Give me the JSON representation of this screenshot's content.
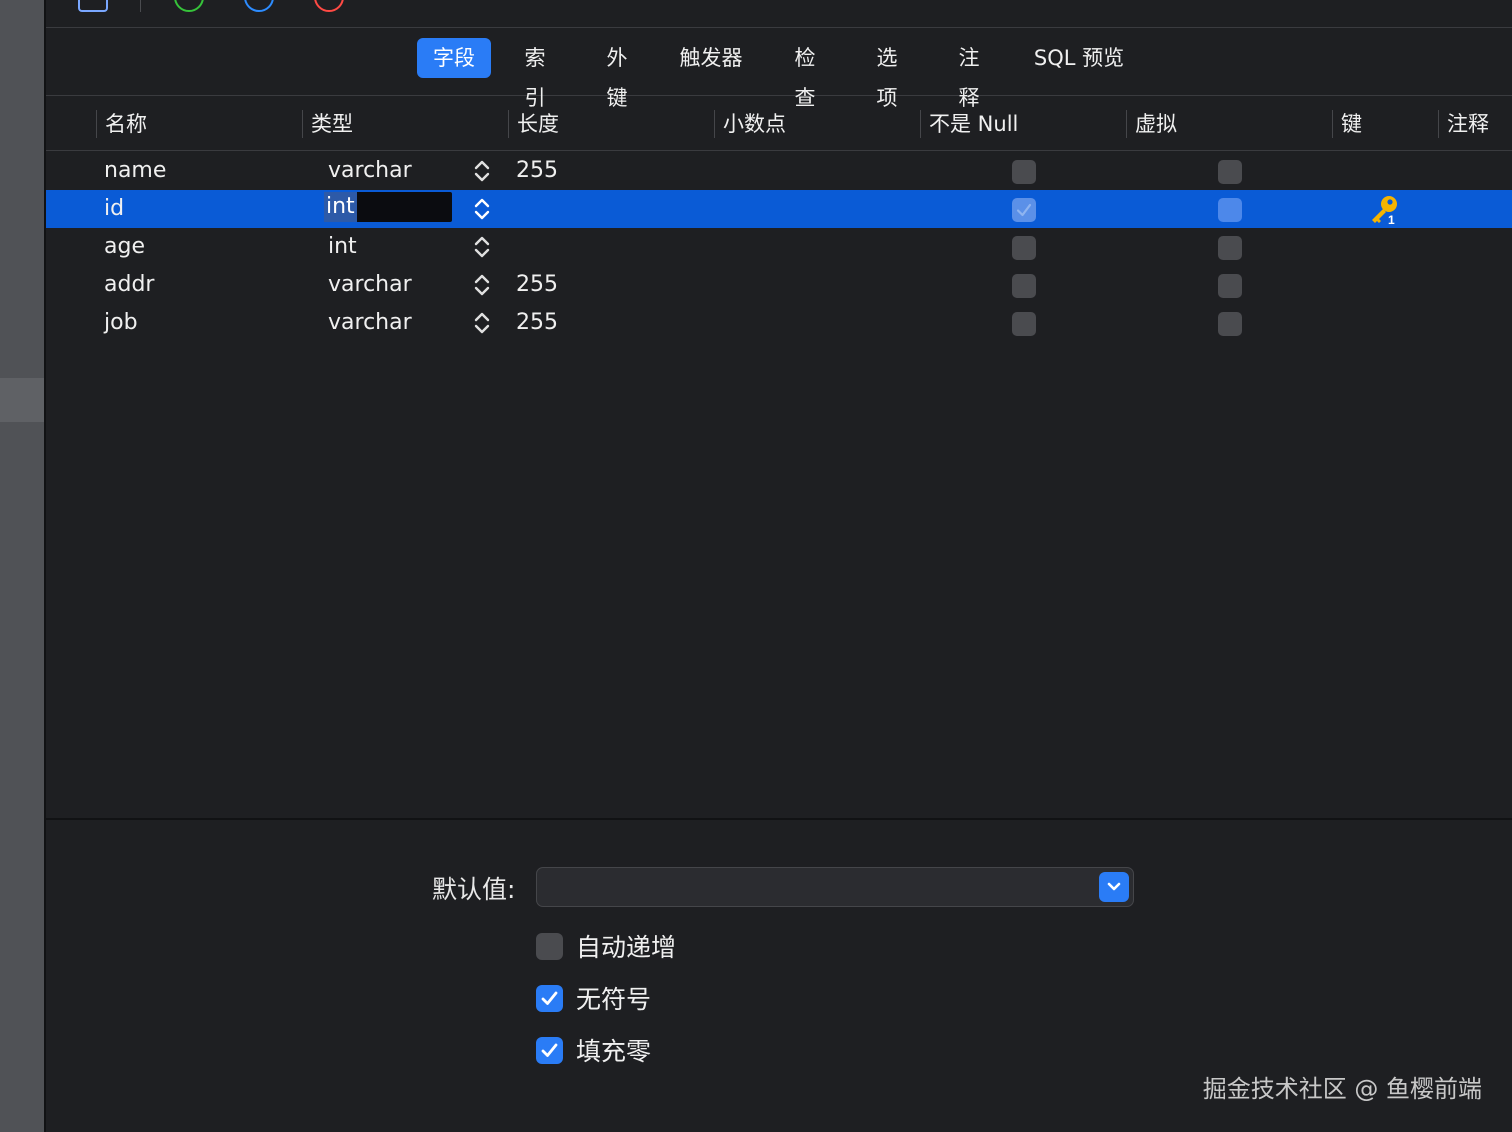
{
  "tabs": [
    {
      "label": "字段",
      "active": true
    },
    {
      "label": "索引",
      "active": false
    },
    {
      "label": "外键",
      "active": false
    },
    {
      "label": "触发器",
      "active": false
    },
    {
      "label": "检查",
      "active": false
    },
    {
      "label": "选项",
      "active": false
    },
    {
      "label": "注释",
      "active": false
    },
    {
      "label": "SQL 预览",
      "active": false
    }
  ],
  "columns": {
    "name": "名称",
    "type": "类型",
    "length": "长度",
    "decimal": "小数点",
    "not_null": "不是 Null",
    "virtual": "虚拟",
    "key": "键",
    "comment": "注释"
  },
  "rows": [
    {
      "name": "name",
      "type": "varchar",
      "length": "255",
      "not_null": false,
      "virtual": false,
      "key": false,
      "selected": false
    },
    {
      "name": "id",
      "type": "int",
      "length": "",
      "not_null": true,
      "virtual": false,
      "key": true,
      "selected": true
    },
    {
      "name": "age",
      "type": "int",
      "length": "",
      "not_null": false,
      "virtual": false,
      "key": false,
      "selected": false
    },
    {
      "name": "addr",
      "type": "varchar",
      "length": "255",
      "not_null": false,
      "virtual": false,
      "key": false,
      "selected": false
    },
    {
      "name": "job",
      "type": "varchar",
      "length": "255",
      "not_null": false,
      "virtual": false,
      "key": false,
      "selected": false
    }
  ],
  "properties": {
    "default_label": "默认值:",
    "default_value": "",
    "options": [
      {
        "label": "自动递增",
        "checked": false
      },
      {
        "label": "无符号",
        "checked": true
      },
      {
        "label": "填充零",
        "checked": true
      }
    ]
  },
  "watermark": "掘金技术社区 @ 鱼樱前端",
  "colors": {
    "accent": "#2a7cf6",
    "selected_row": "#0a5bd6",
    "key_icon": "#f5b400"
  }
}
